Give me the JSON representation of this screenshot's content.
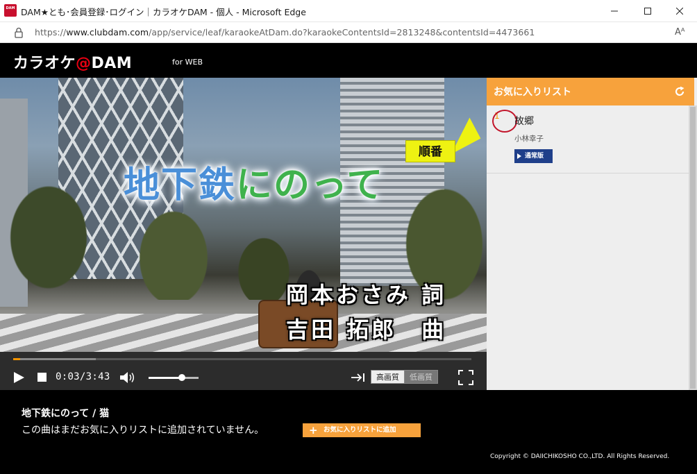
{
  "browser": {
    "favicon_text": "DAM",
    "window_title": "DAM★とも･会員登録･ログイン｜カラオケDAM - 個人 - Microsoft Edge",
    "url_prefix": "https://",
    "url_host": "www.clubdam.com",
    "url_path": "/app/service/leaf/karaokeAtDam.do?karaokeContentsId=2813248&contentsId=4473661",
    "read_aloud_glyph": "Aᴬ",
    "icons": [
      "lock-icon",
      "read-aloud-icon",
      "minimize-icon",
      "maximize-icon",
      "close-icon"
    ]
  },
  "site": {
    "logo_prefix": "カラオケ",
    "logo_at": "@",
    "logo_suffix": "DAM",
    "logo_sub": "for WEB",
    "brand_color": "#e60012"
  },
  "video": {
    "overlay_title_a": "地下鉄",
    "overlay_title_b": "にのって",
    "credit_lyricist": "岡本おさみ 詞",
    "credit_composer": "吉田 拓郎　曲",
    "callout": "順番"
  },
  "player": {
    "time": "0:03/3:43",
    "progress": 0.015,
    "buffered": 0.18,
    "volume": 0.67,
    "quality_high": "高画質",
    "quality_low": "低画質",
    "selected_quality": "高画質",
    "accent": "#f29400",
    "icons": [
      "play-icon",
      "stop-icon",
      "volume-icon",
      "skip-end-icon",
      "fullscreen-icon"
    ]
  },
  "favorites": {
    "title": "お気に入りリスト",
    "header_color": "#f7a23c",
    "items": [
      {
        "rank": "1",
        "song": "故郷",
        "artist": "小林幸子",
        "badge": "通常版"
      }
    ]
  },
  "info": {
    "title": "地下鉄にのって / 猫",
    "message": "この曲はまだお気に入りリストに追加されていません。",
    "add_button": "お気に入りリストに追加",
    "copyright": "Copyright © DAIICHIKOSHO CO.,LTD. All Rights Reserved."
  }
}
